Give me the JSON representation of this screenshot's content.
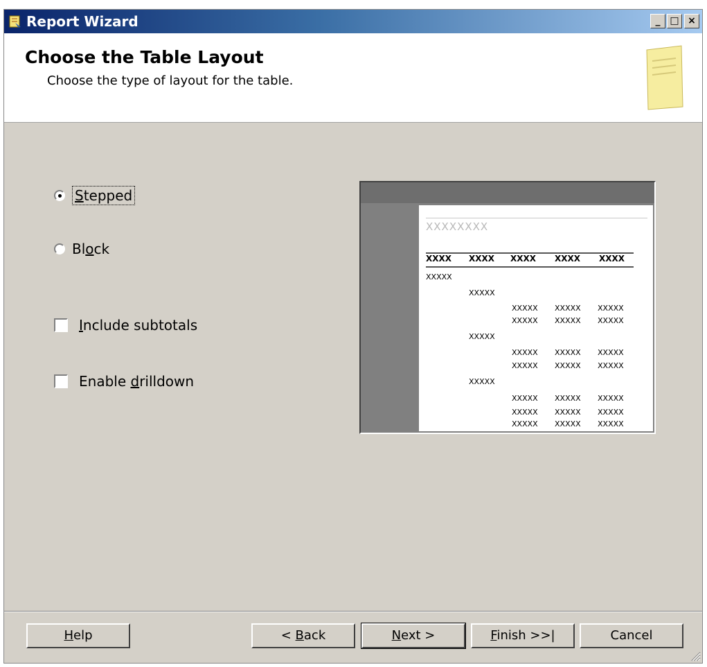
{
  "window": {
    "title": "Report Wizard",
    "controls": {
      "minimize": "_",
      "maximize": "□",
      "close": "×"
    }
  },
  "header": {
    "title": "Choose the Table Layout",
    "subtitle": "Choose the type of layout for the table."
  },
  "options": {
    "stepped": {
      "label_pre": "",
      "mnemonic": "S",
      "label_post": "tepped",
      "selected": true
    },
    "block": {
      "label_pre": "Bl",
      "mnemonic": "o",
      "label_post": "ck",
      "selected": false
    },
    "subtotals": {
      "label_pre": "",
      "mnemonic": "I",
      "label_post": "nclude subtotals",
      "checked": false
    },
    "drilldown": {
      "label_pre": "Enable ",
      "mnemonic": "d",
      "label_post": "rilldown",
      "checked": false
    }
  },
  "preview": {
    "title_placeholder": "XXXXXXXX",
    "header_cells": [
      "XXXX",
      "XXXX",
      "XXXX",
      "XXXX",
      "XXXX"
    ],
    "cell": "XXXXX"
  },
  "buttons": {
    "help": {
      "pre": "",
      "mnemonic": "H",
      "post": "elp"
    },
    "back": {
      "pre": "< ",
      "mnemonic": "B",
      "post": "ack"
    },
    "next": {
      "pre": "",
      "mnemonic": "N",
      "post": "ext >"
    },
    "finish": {
      "pre": "",
      "mnemonic": "F",
      "post": "inish >>|"
    },
    "cancel": {
      "pre": "Cancel",
      "mnemonic": "",
      "post": ""
    }
  }
}
